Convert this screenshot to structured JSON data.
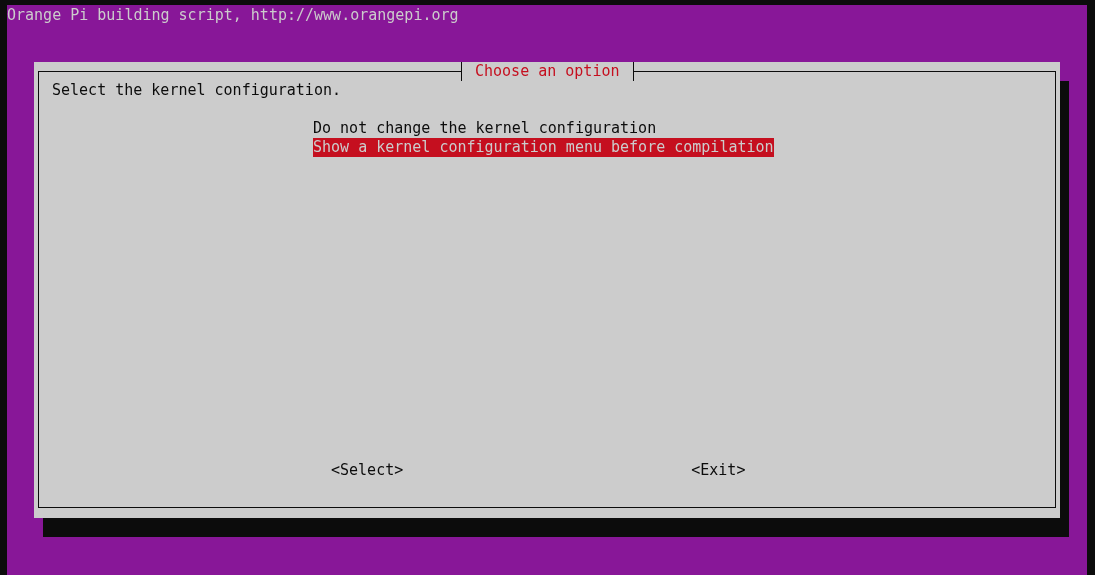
{
  "header": {
    "title": "Orange Pi building script, http://www.orangepi.org"
  },
  "dialog": {
    "title": "Choose an option",
    "prompt": "Select the kernel configuration.",
    "menu": [
      {
        "label": "Do not change the kernel configuration",
        "selected": false
      },
      {
        "label": "Show a kernel configuration menu before compilation",
        "selected": true
      }
    ],
    "buttons": [
      "<Select>",
      "<Exit>"
    ]
  }
}
